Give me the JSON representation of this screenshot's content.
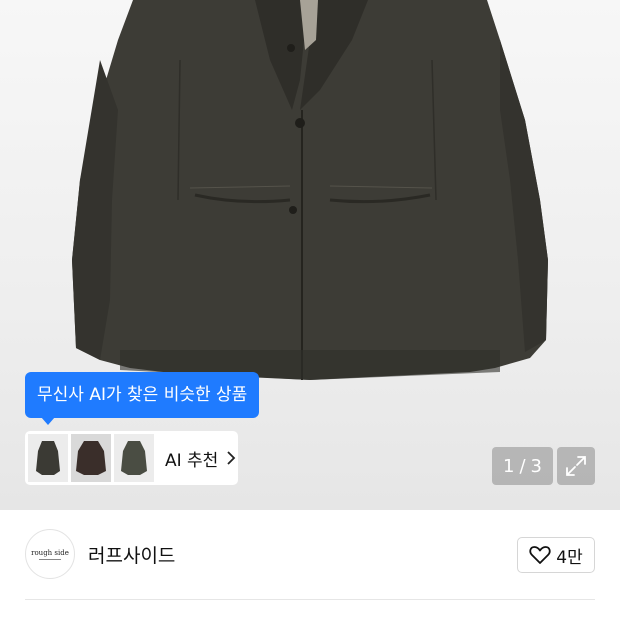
{
  "product_gallery": {
    "image_alt": "jacket-photo",
    "ai_tooltip": "무신사 AI가 찾은 비슷한 상품",
    "ai_recommend_label": "AI 추천",
    "counter": {
      "current": "1",
      "separator": "/",
      "total": "3"
    },
    "icons": {
      "expand": "expand-icon",
      "chevron": "chevron-right-icon"
    }
  },
  "brand": {
    "logo_text": "rough side",
    "name": "러프사이드",
    "like_count": "4만",
    "like_icon": "heart-icon"
  },
  "colors": {
    "accent": "#1f7bff",
    "jacket": "#3b3a34"
  }
}
